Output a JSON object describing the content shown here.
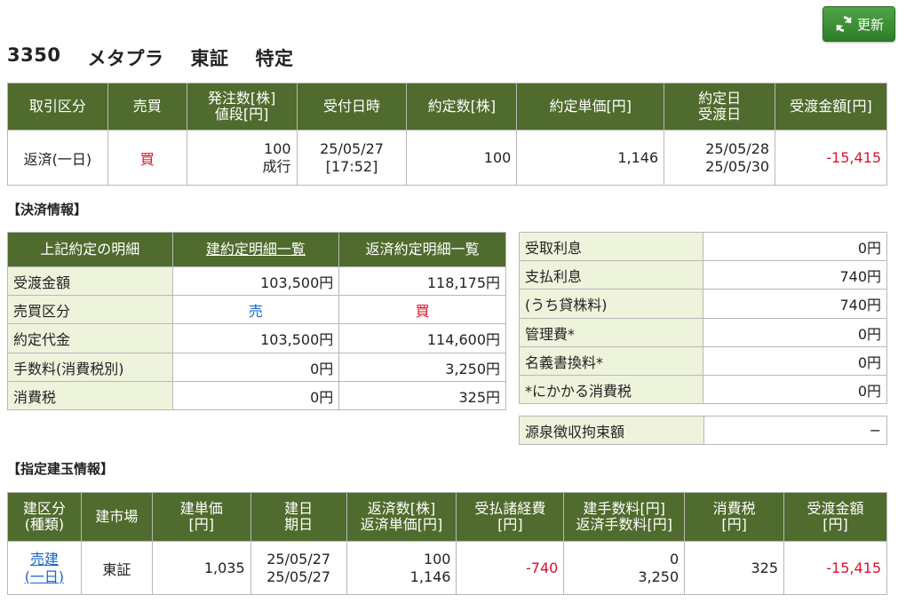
{
  "header": {
    "refresh_label": "更新",
    "code": "3350",
    "name": "メタプラ",
    "market": "東証",
    "account": "特定"
  },
  "order_table": {
    "headers": [
      "取引区分",
      "売買",
      "発注数[株]",
      "値段[円]",
      "受付日時",
      "約定数[株]",
      "約定単価[円]",
      "約定日",
      "受渡日",
      "受渡金額[円]"
    ],
    "row": {
      "type": "返済(一日)",
      "side": "買",
      "order_qty": "100",
      "price_type": "成行",
      "recv_date": "25/05/27",
      "recv_time": "[17:52]",
      "exec_qty": "100",
      "exec_price": "1,146",
      "exec_date": "25/05/28",
      "settle_date": "25/05/30",
      "amount": "-15,415"
    }
  },
  "settlement_label": "【決済情報】",
  "settlement_table": {
    "headers": [
      "上記約定の明細",
      "建約定明細一覧",
      "返済約定明細一覧"
    ],
    "rows": [
      {
        "label": "受渡金額",
        "open": "103,500円",
        "close": "118,175円"
      },
      {
        "label": "売買区分",
        "open": "売",
        "close": "買"
      },
      {
        "label": "約定代金",
        "open": "103,500円",
        "close": "114,600円"
      },
      {
        "label": "手数料(消費税別)",
        "open": "0円",
        "close": "3,250円"
      },
      {
        "label": "消費税",
        "open": "0円",
        "close": "325円"
      }
    ]
  },
  "interest_table": {
    "rows": [
      {
        "label": "受取利息",
        "value": "0円"
      },
      {
        "label": "支払利息",
        "value": "740円"
      },
      {
        "label": "(うち貸株料)",
        "value": "740円"
      },
      {
        "label": "管理費*",
        "value": "0円"
      },
      {
        "label": "名義書換料*",
        "value": "0円"
      },
      {
        "label": "*にかかる消費税",
        "value": "0円"
      }
    ]
  },
  "withholding": {
    "label": "源泉徴収拘束額",
    "value": "−"
  },
  "position_label": "【指定建玉情報】",
  "position_table": {
    "headers": [
      [
        "建区分",
        "(種類)"
      ],
      [
        "建市場"
      ],
      [
        "建単価",
        "[円]"
      ],
      [
        "建日",
        "期日"
      ],
      [
        "返済数[株]",
        "返済単価[円]"
      ],
      [
        "受払諸経費",
        "[円]"
      ],
      [
        "建手数料[円]",
        "返済手数料[円]"
      ],
      [
        "消費税",
        "[円]"
      ],
      [
        "受渡金額",
        "[円]"
      ]
    ],
    "row": {
      "type1": "売建",
      "type2": "(一日)",
      "market": "東証",
      "open_price": "1,035",
      "open_date": "25/05/27",
      "due_date": "25/05/27",
      "close_qty": "100",
      "close_price": "1,146",
      "expenses": "-740",
      "open_fee": "0",
      "close_fee": "3,250",
      "tax": "325",
      "amount": "-15,415"
    }
  }
}
